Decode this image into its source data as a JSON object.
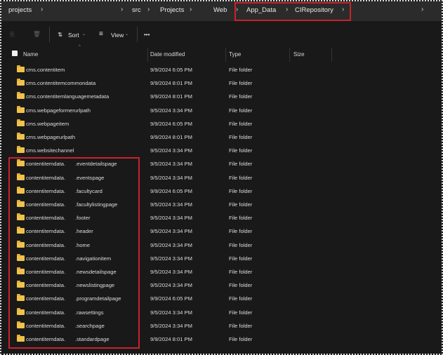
{
  "breadcrumb": [
    "projects",
    "src",
    "Projects",
    "Web",
    "App_Data",
    "CIRepository"
  ],
  "toolbar": {
    "sort": "Sort",
    "view": "View",
    "more": "•••"
  },
  "columns": {
    "name": "Name",
    "date": "Date modified",
    "type": "Type",
    "size": "Size"
  },
  "colors": {
    "highlight": "#c8232c",
    "folder": "#f0c24a"
  },
  "files": [
    {
      "name": "cms.contentitem",
      "date": "9/9/2024 6:05 PM",
      "type": "File folder"
    },
    {
      "name": "cms.contentitemcommondata",
      "date": "9/9/2024 8:01 PM",
      "type": "File folder"
    },
    {
      "name": "cms.contentitemlanguagemetadata",
      "date": "9/9/2024 8:01 PM",
      "type": "File folder"
    },
    {
      "name": "cms.webpageformerurlpath",
      "date": "9/5/2024 3:34 PM",
      "type": "File folder"
    },
    {
      "name": "cms.webpageitem",
      "date": "9/9/2024 6:05 PM",
      "type": "File folder"
    },
    {
      "name": "cms.webpageurlpath",
      "date": "9/9/2024 8:01 PM",
      "type": "File folder"
    },
    {
      "name": "cms.websitechannel",
      "date": "9/5/2024 3:34 PM",
      "type": "File folder"
    },
    {
      "name": "contentitemdata.",
      "suffix": ".eventdetailspage",
      "date": "9/5/2024 3:34 PM",
      "type": "File folder"
    },
    {
      "name": "contentitemdata.",
      "suffix": ".eventspage",
      "date": "9/5/2024 3:34 PM",
      "type": "File folder"
    },
    {
      "name": "contentitemdata.",
      "suffix": ".facultycard",
      "date": "9/9/2024 6:05 PM",
      "type": "File folder"
    },
    {
      "name": "contentitemdata.",
      "suffix": ".facultylistingpage",
      "date": "9/5/2024 3:34 PM",
      "type": "File folder"
    },
    {
      "name": "contentitemdata.",
      "suffix": ".footer",
      "date": "9/5/2024 3:34 PM",
      "type": "File folder"
    },
    {
      "name": "contentitemdata.",
      "suffix": ".header",
      "date": "9/5/2024 3:34 PM",
      "type": "File folder"
    },
    {
      "name": "contentitemdata.",
      "suffix": ".home",
      "date": "9/5/2024 3:34 PM",
      "type": "File folder"
    },
    {
      "name": "contentitemdata.",
      "suffix": ".navigationitem",
      "date": "9/5/2024 3:34 PM",
      "type": "File folder"
    },
    {
      "name": "contentitemdata.",
      "suffix": ".newsdetailspage",
      "date": "9/5/2024 3:34 PM",
      "type": "File folder"
    },
    {
      "name": "contentitemdata.",
      "suffix": ".newslistingpage",
      "date": "9/5/2024 3:34 PM",
      "type": "File folder"
    },
    {
      "name": "contentitemdata.",
      "suffix": ".programdetailpage",
      "date": "9/9/2024 6:05 PM",
      "type": "File folder"
    },
    {
      "name": "contentitemdata.",
      "suffix": ".rawsettings",
      "date": "9/5/2024 3:34 PM",
      "type": "File folder"
    },
    {
      "name": "contentitemdata.",
      "suffix": ".searchpage",
      "date": "9/5/2024 3:34 PM",
      "type": "File folder"
    },
    {
      "name": "contentitemdata.",
      "suffix": ".standardpage",
      "date": "9/9/2024 8:01 PM",
      "type": "File folder"
    }
  ]
}
